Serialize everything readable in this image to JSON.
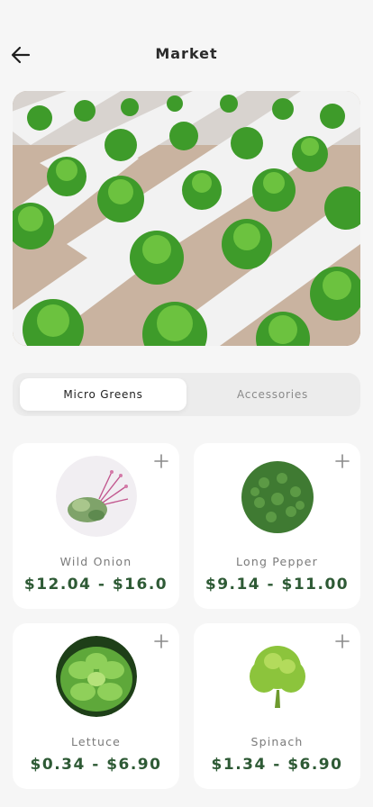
{
  "header": {
    "title": "Market",
    "back_icon": "arrow-left-icon"
  },
  "hero": {
    "image": "hydroponic-lettuce-rows"
  },
  "tabs": [
    {
      "label": "Micro Greens",
      "selected": true
    },
    {
      "label": "Accessories",
      "selected": false
    }
  ],
  "products": [
    {
      "name": "Wild Onion",
      "price": "$12.04 - $16.0",
      "image": "microgreens-sprouts",
      "add_icon": "plus-icon"
    },
    {
      "name": "Long Pepper",
      "price": "$9.14 - $11.00",
      "image": "green-leaf-pile",
      "add_icon": "plus-icon"
    },
    {
      "name": "Lettuce",
      "price": "$0.34 - $6.90",
      "image": "lettuce-rosette",
      "add_icon": "plus-icon"
    },
    {
      "name": "Spinach",
      "price": "$1.34 - $6.90",
      "image": "leafy-green-head",
      "add_icon": "plus-icon"
    }
  ],
  "colors": {
    "background": "#f6f6f6",
    "price": "#2e5a35",
    "card": "#ffffff"
  }
}
